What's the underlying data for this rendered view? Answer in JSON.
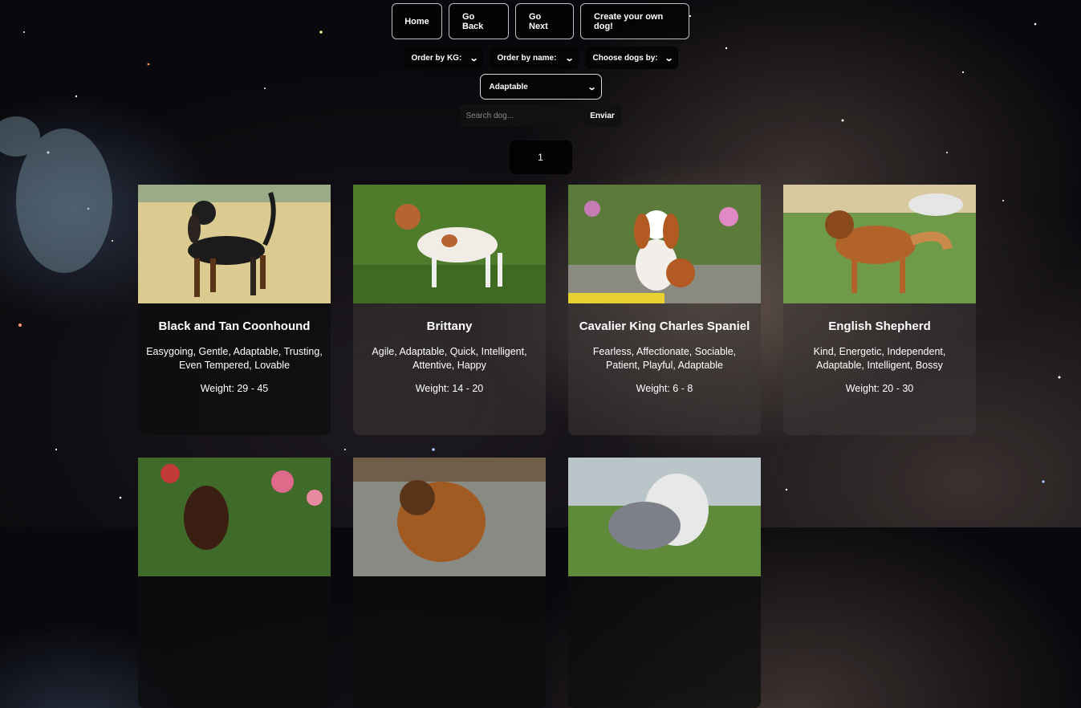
{
  "nav": {
    "home": "Home",
    "back": "Go Back",
    "next": "Go Next",
    "create": "Create your own dog!"
  },
  "filters": {
    "order_kg": "Order by KG:",
    "order_name": "Order by name:",
    "choose_by": "Choose dogs by:",
    "temperament": "Adaptable"
  },
  "search": {
    "placeholder": "Search dog...",
    "submit": "Enviar"
  },
  "pagination": {
    "current": "1"
  },
  "cards": [
    {
      "name": "Black and Tan Coonhound",
      "temperament": "Easygoing, Gentle, Adaptable, Trusting, Even Tempered, Lovable",
      "weight": "Weight: 29 - 45"
    },
    {
      "name": "Brittany",
      "temperament": "Agile, Adaptable, Quick, Intelligent, Attentive, Happy",
      "weight": "Weight: 14 - 20"
    },
    {
      "name": "Cavalier King Charles Spaniel",
      "temperament": "Fearless, Affectionate, Sociable, Patient, Playful, Adaptable",
      "weight": "Weight: 6 - 8"
    },
    {
      "name": "English Shepherd",
      "temperament": "Kind, Energetic, Independent, Adaptable, Intelligent, Bossy",
      "weight": "Weight: 20 - 30"
    }
  ],
  "icons": {
    "dropdown": "chevron-down-icon"
  },
  "colors": {
    "page_bg": "#09080c",
    "button_border": "#ffffff",
    "card_bg": "#0c0c0e"
  }
}
